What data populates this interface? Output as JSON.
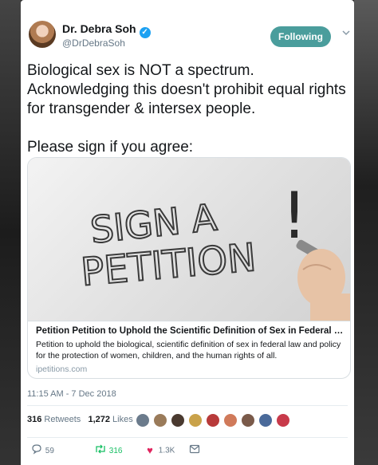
{
  "user": {
    "name": "Dr. Debra Soh",
    "handle": "@DrDebraSoh",
    "verified_icon": "verified-badge-icon"
  },
  "follow_button": {
    "label": "Following",
    "color": "#4a9d9c"
  },
  "tweet": {
    "line1": "Biological sex is NOT a spectrum. Acknowledging this doesn't prohibit equal rights for transgender & intersex people.",
    "line2": "Please sign if you agree:"
  },
  "link_card": {
    "image_text": [
      "SIGN A",
      "PETITION",
      "!"
    ],
    "title": "Petition Petition to Uphold the Scientific Definition of Sex in Federal Law ...",
    "description": "Petition to uphold the biological, scientific definition of sex in federal law and policy for the protection of women, children, and the human rights of all.",
    "domain": "ipetitions.com"
  },
  "timestamp": "11:15 AM - 7 Dec 2018",
  "stats": {
    "retweets_count": "316",
    "retweets_label": "Retweets",
    "likes_count": "1,272",
    "likes_label": "Likes"
  },
  "actions": {
    "reply_count": "59",
    "retweet_count": "316",
    "like_count": "1.3K",
    "icons": [
      "reply-icon",
      "retweet-icon",
      "heart-icon",
      "message-icon"
    ],
    "retweet_color": "#17bf63",
    "like_color": "#e0245e"
  }
}
